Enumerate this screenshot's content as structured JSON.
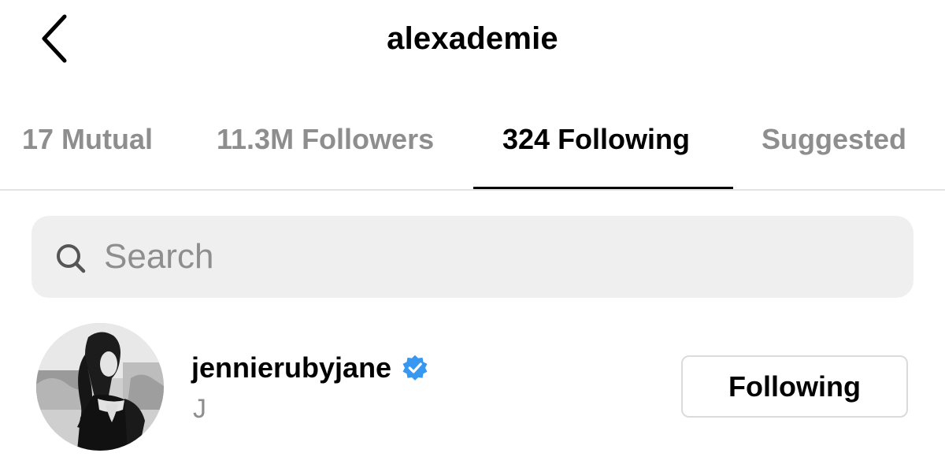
{
  "header": {
    "title": "alexademie",
    "back_icon": "chevron-left-icon"
  },
  "tabs": [
    {
      "label": "17 Mutual",
      "active": false
    },
    {
      "label": "11.3M Followers",
      "active": false
    },
    {
      "label": "324 Following",
      "active": true
    },
    {
      "label": "Suggested",
      "active": false
    }
  ],
  "search": {
    "placeholder": "Search",
    "value": "",
    "icon": "search-icon"
  },
  "list": [
    {
      "username": "jennierubyjane",
      "name": "J",
      "verified": true,
      "button_label": "Following"
    }
  ],
  "colors": {
    "verified_badge": "#3897f0",
    "inactive_tab_text": "#8e8e8e",
    "search_background": "#efefef",
    "button_border": "#dbdbdb"
  }
}
